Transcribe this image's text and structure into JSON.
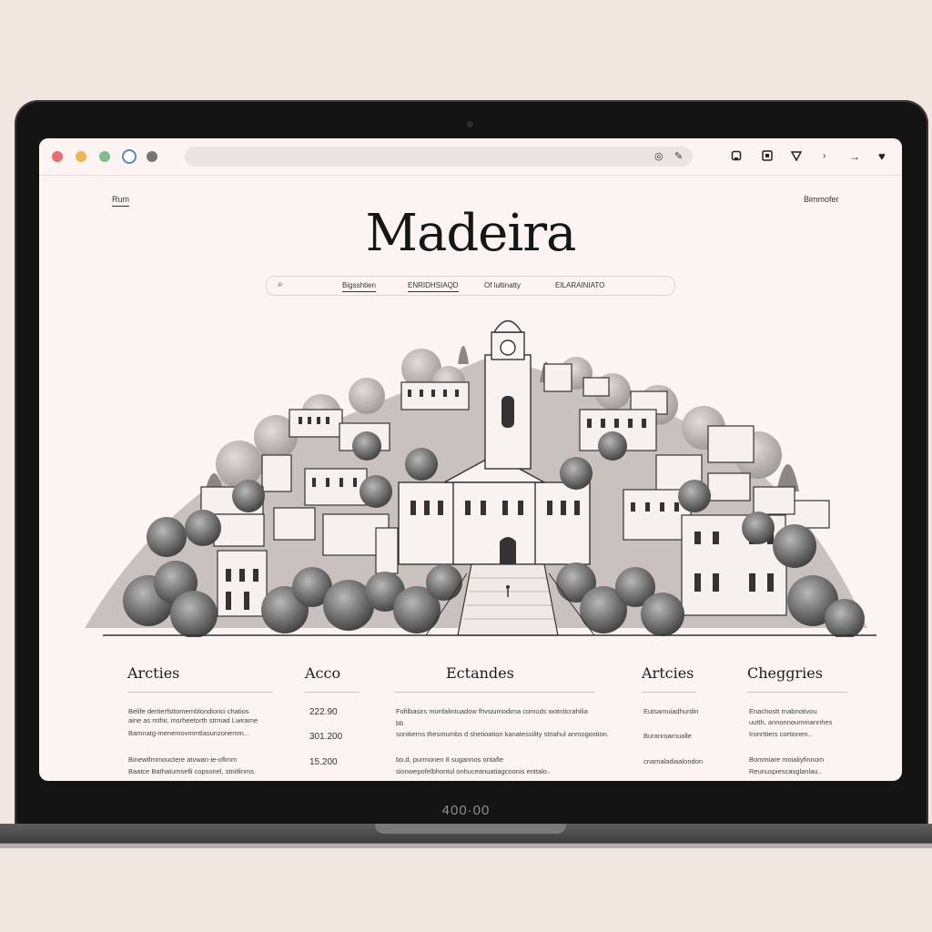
{
  "browser": {
    "toolbar_icons": [
      "bookmark-icon",
      "square-icon",
      "shield-icon",
      "chevron-icon",
      "arrow-icon",
      "heart-icon"
    ]
  },
  "page": {
    "top_left_link": "Rum",
    "top_right_link": "Bimmofer",
    "title": "Madeira",
    "nav": {
      "items": [
        "Bigsshtien",
        "ENRIDHSIAQD",
        "Of lultinatty",
        "EILARAINIATO"
      ]
    }
  },
  "footer": {
    "columns": [
      {
        "heading": "Arcties",
        "lines": [
          "Belife dertierfsttomemblondiorici chatios",
          "aine as mthir, msrheetorth strmad Lwirame",
          "Bamnatg-menemovmmtlasunzonemm...",
          "Binewtfmmouctere atvwan-ie-oflmm",
          "Baatce Bathatumselli copsonel, stnitlinms."
        ]
      },
      {
        "heading": "Acco",
        "lines": [
          "222.90",
          "301.200",
          "15.200"
        ]
      },
      {
        "heading": "Ectandes",
        "lines": [
          "Fofilbasirs monfalintuadow fhvsiumodima comuds wotnticrahilia",
          "bb",
          "sonitierns thesmumbs d shetioation kanatessility striahul anmogostion.",
          "bo.d, purmonen 8 sugannos oritafle",
          "sionwepofelbhontul onhuceanuatiagcoonis enttalo.."
        ]
      },
      {
        "heading": "Artcies",
        "lines": [
          "Eutsamuiadhurdin",
          "Buranroamualle",
          "cnamaladiaalondon"
        ]
      },
      {
        "heading": "Cheggries",
        "lines": [
          "Enachostt rnabnotivou",
          "uutth, annonnoummannhes",
          "Ironrttiers cortionen..",
          "Bommiare moialiyfinnom",
          "Reunuspiescasglanlau.."
        ]
      }
    ]
  },
  "device": {
    "chin_label": "400·00"
  }
}
